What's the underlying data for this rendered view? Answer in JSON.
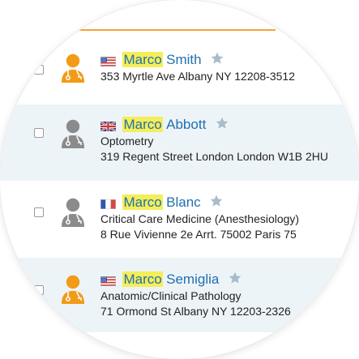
{
  "colors": {
    "accent": "#f4a23b",
    "link": "#2170b0",
    "highlight": "#f5ee57",
    "shaded_row": "#edf4f8",
    "avatar_orange": "#f39a17",
    "avatar_gray": "#8b8b8b",
    "star": "#a8bccd"
  },
  "results": [
    {
      "flag": "us-flag",
      "avatar": "doctor-orange-icon",
      "first_name": "Marco",
      "last_name": "Smith",
      "specialty": "",
      "address": "353 Myrtle Ave Albany NY 12208-3512"
    },
    {
      "flag": "uk-flag",
      "avatar": "doctor-gray-icon",
      "first_name": "Marco",
      "last_name": "Abbott",
      "specialty": "Optometry",
      "address": "319 Regent Street London London W1B 2HU"
    },
    {
      "flag": "fr-flag",
      "avatar": "doctor-gray-icon",
      "first_name": "Marco",
      "last_name": "Blanc",
      "specialty": "Critical Care Medicine (Anesthesiology)",
      "address": "8 Rue Vivienne 2e Arrt. 75002 Paris 75"
    },
    {
      "flag": "us-flag",
      "avatar": "doctor-orange-icon",
      "first_name": "Marco",
      "last_name": "Semiglia",
      "specialty": "Anatomic/Clinical Pathology",
      "address": "71 Ormond St Albany NY 12203-2326"
    }
  ]
}
